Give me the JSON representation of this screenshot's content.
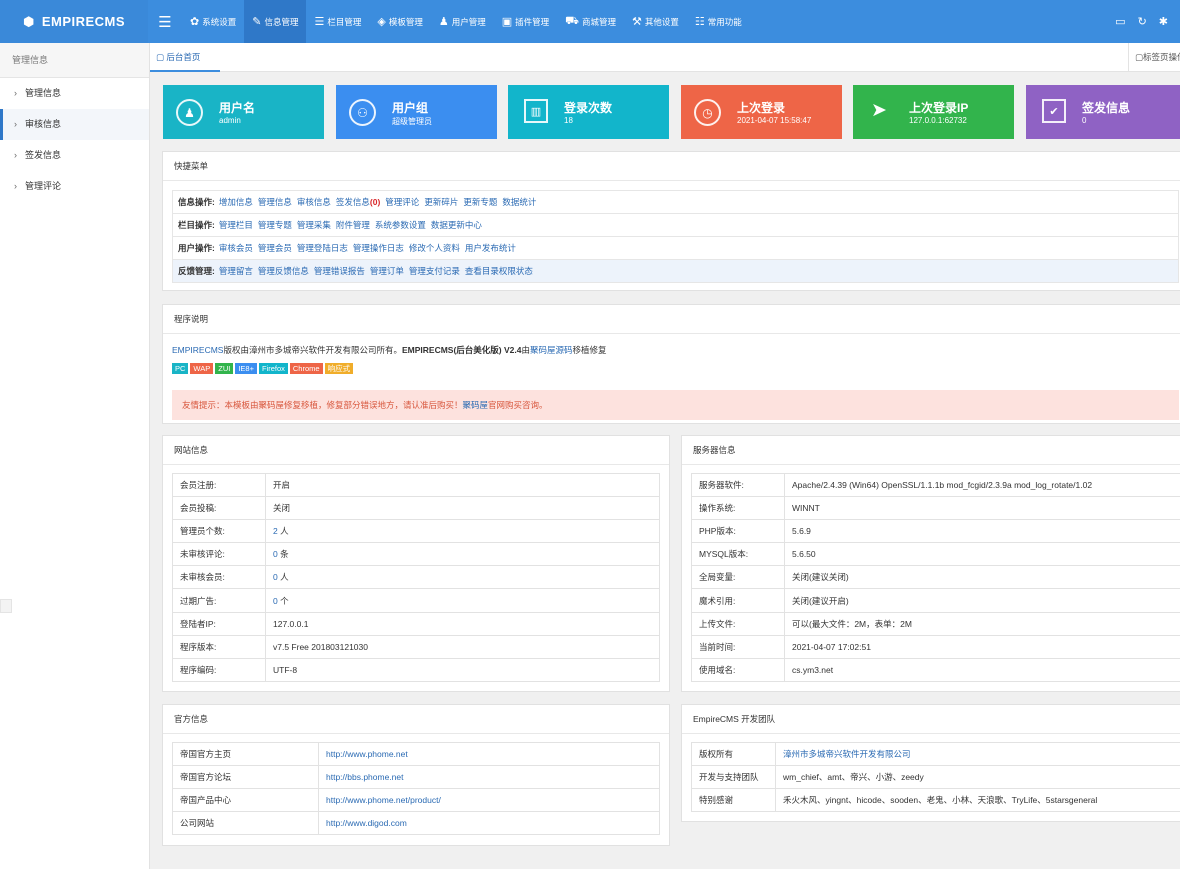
{
  "app": {
    "logo_icon": "cube-icon",
    "logo": "EMPIRECMS"
  },
  "topmenu": [
    {
      "icon": "gear-icon",
      "glyph": "✿",
      "label": "系统设置"
    },
    {
      "icon": "edit-icon",
      "glyph": "✎",
      "label": "信息管理",
      "active": true
    },
    {
      "icon": "list-icon",
      "glyph": "☰",
      "label": "栏目管理"
    },
    {
      "icon": "layers-icon",
      "glyph": "◈",
      "label": "模板管理"
    },
    {
      "icon": "user-icon",
      "glyph": "♟",
      "label": "用户管理"
    },
    {
      "icon": "plugin-icon",
      "glyph": "▣",
      "label": "插件管理"
    },
    {
      "icon": "cart-icon",
      "glyph": "⛟",
      "label": "商城管理"
    },
    {
      "icon": "wrench-icon",
      "glyph": "⚒",
      "label": "其他设置"
    },
    {
      "icon": "sliders-icon",
      "glyph": "☷",
      "label": "常用功能"
    }
  ],
  "toolbar_icons": [
    "monitor-icon",
    "refresh-icon",
    "settings-icon"
  ],
  "sidebar": {
    "header": "管理信息",
    "items": [
      {
        "label": "管理信息"
      },
      {
        "label": "审核信息",
        "active": true
      },
      {
        "label": "签发信息"
      },
      {
        "label": "管理评论"
      }
    ]
  },
  "tabs": {
    "home": "后台首页",
    "ops": "标签页操作"
  },
  "stats": [
    {
      "title": "用户名",
      "value": "admin",
      "color": "#19b4c6",
      "icon": "user-circle-icon",
      "glyph": "♟"
    },
    {
      "title": "用户组",
      "value": "超级管理员",
      "color": "#3b8ef0",
      "icon": "users-icon",
      "glyph": "⚇"
    },
    {
      "title": "登录次数",
      "value": "18",
      "color": "#12b5cb",
      "icon": "bar-chart-icon",
      "glyph": "▥"
    },
    {
      "title": "上次登录",
      "value": "2021-04-07 15:58:47",
      "color": "#ee6547",
      "icon": "clock-icon",
      "glyph": "◷"
    },
    {
      "title": "上次登录IP",
      "value": "127.0.0.1:62732",
      "color": "#32b44c",
      "icon": "location-arrow-icon",
      "glyph": "➤"
    },
    {
      "title": "签发信息",
      "value": "0",
      "color": "#8f62c4",
      "icon": "check-square-icon",
      "glyph": "✔"
    }
  ],
  "quick": {
    "title": "快捷菜单",
    "rows": [
      {
        "label": "信息操作:",
        "links": [
          "增加信息",
          "管理信息",
          "审核信息",
          "签发信息",
          "管理评论",
          "更新碎片",
          "更新专题",
          "数据统计"
        ],
        "sign_count": "(0)"
      },
      {
        "label": "栏目操作:",
        "links": [
          "管理栏目",
          "管理专题",
          "管理采集",
          "附件管理",
          "系统参数设置",
          "数据更新中心"
        ]
      },
      {
        "label": "用户操作:",
        "links": [
          "审核会员",
          "管理会员",
          "管理登陆日志",
          "管理操作日志",
          "修改个人资料",
          "用户发布统计"
        ]
      },
      {
        "label": "反馈管理:",
        "links": [
          "管理留言",
          "管理反馈信息",
          "管理错误报告",
          "管理订单",
          "管理支付记录",
          "查看目录权限状态"
        ]
      }
    ]
  },
  "program": {
    "title": "程序说明",
    "brand": "EMPIRECMS",
    "text1": "版权由漳州市多城帝兴软件开发有限公司所有。",
    "bold": "EMPIRECMS(后台美化版) V2.4",
    "by": "由",
    "author": "聚码屋源码",
    "after": "移植修复",
    "badges": [
      {
        "t": "PC",
        "c": "#19b4c6"
      },
      {
        "t": "WAP",
        "c": "#ee6547"
      },
      {
        "t": "ZUI",
        "c": "#32b44c"
      },
      {
        "t": "IE8+",
        "c": "#3b8ef0"
      },
      {
        "t": "Firefox",
        "c": "#12b5cb"
      },
      {
        "t": "Chrome",
        "c": "#ee6547"
      },
      {
        "t": "响应式",
        "c": "#f0ad2a"
      }
    ],
    "alert_pre": "友情提示：本模板由聚码屋修复移植，修复部分错误地方，请认准后购买！",
    "alert_link": "聚码屋",
    "alert_post": "官网购买咨询。"
  },
  "site": {
    "title": "网站信息",
    "rows": [
      {
        "k": "会员注册:",
        "v": "开启"
      },
      {
        "k": "会员投稿:",
        "v": "关闭"
      },
      {
        "k": "管理员个数:",
        "v": "2",
        "u": " 人",
        "link": true
      },
      {
        "k": "未审核评论:",
        "v": "0",
        "u": " 条",
        "link": true
      },
      {
        "k": "未审核会员:",
        "v": "0",
        "u": " 人",
        "link": true
      },
      {
        "k": "过期广告:",
        "v": "0",
        "u": " 个",
        "link": true
      },
      {
        "k": "登陆者IP:",
        "v": "127.0.0.1"
      },
      {
        "k": "程序版本:",
        "v": "v7.5 Free 201803121030"
      },
      {
        "k": "程序编码:",
        "v": "UTF-8"
      }
    ]
  },
  "server": {
    "title": "服务器信息",
    "rows": [
      {
        "k": "服务器软件:",
        "v": "Apache/2.4.39 (Win64) OpenSSL/1.1.1b mod_fcgid/2.3.9a mod_log_rotate/1.02"
      },
      {
        "k": "操作系统:",
        "v": "WINNT"
      },
      {
        "k": "PHP版本:",
        "v": "5.6.9"
      },
      {
        "k": "MYSQL版本:",
        "v": "5.6.50"
      },
      {
        "k": "全局变量:",
        "v": "关闭(建议关闭)"
      },
      {
        "k": "魔术引用:",
        "v": "关闭(建议开启)"
      },
      {
        "k": "上传文件:",
        "v": "可以(最大文件：2M，表单：2M"
      },
      {
        "k": "当前时间:",
        "v": "2021-04-07 17:02:51"
      },
      {
        "k": "使用域名:",
        "v": "cs.ym3.net"
      }
    ]
  },
  "official": {
    "title": "官方信息",
    "rows": [
      {
        "k": "帝国官方主页",
        "v": "http://www.phome.net"
      },
      {
        "k": "帝国官方论坛",
        "v": "http://bbs.phome.net"
      },
      {
        "k": "帝国产品中心",
        "v": "http://www.phome.net/product/"
      },
      {
        "k": "公司网站",
        "v": "http://www.digod.com"
      }
    ]
  },
  "team": {
    "title": "EmpireCMS 开发团队",
    "rows": [
      {
        "k": "版权所有",
        "v": "漳州市多城帝兴软件开发有限公司",
        "link": true
      },
      {
        "k": "开发与支持团队",
        "v": "wm_chief、amt、帝兴、小游、zeedy"
      },
      {
        "k": "特别感谢",
        "v": "禾火木风、yingnt、hicode、sooden、老鬼、小林、天浪歌、TryLife、5starsgeneral"
      }
    ]
  }
}
